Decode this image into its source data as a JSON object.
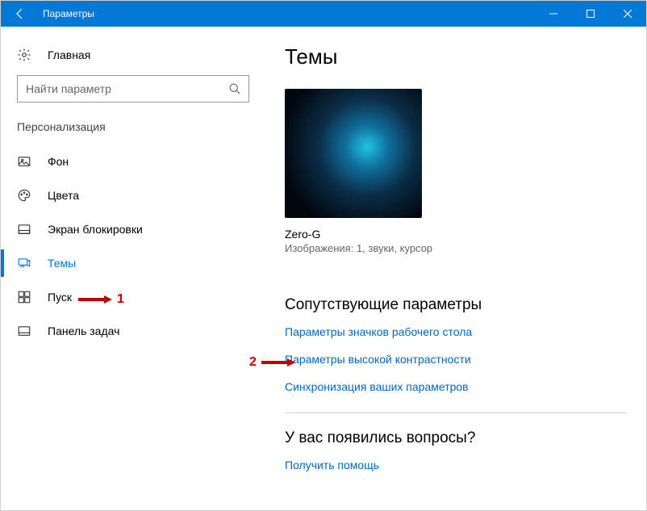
{
  "titlebar": {
    "title": "Параметры"
  },
  "sidebar": {
    "home": "Главная",
    "search_placeholder": "Найти параметр",
    "group": "Персонализация",
    "items": [
      {
        "label": "Фон"
      },
      {
        "label": "Цвета"
      },
      {
        "label": "Экран блокировки"
      },
      {
        "label": "Темы"
      },
      {
        "label": "Пуск"
      },
      {
        "label": "Панель задач"
      }
    ]
  },
  "main": {
    "title": "Темы",
    "theme": {
      "name": "Zero-G",
      "desc": "Изображения: 1, звуки, курсор"
    },
    "related": {
      "heading": "Сопутствующие параметры",
      "links": [
        "Параметры значков рабочего стола",
        "Параметры высокой контрастности",
        "Синхронизация ваших параметров"
      ]
    },
    "help": {
      "heading": "У вас появились вопросы?",
      "link": "Получить помощь"
    }
  },
  "annotations": {
    "one": "1",
    "two": "2"
  }
}
